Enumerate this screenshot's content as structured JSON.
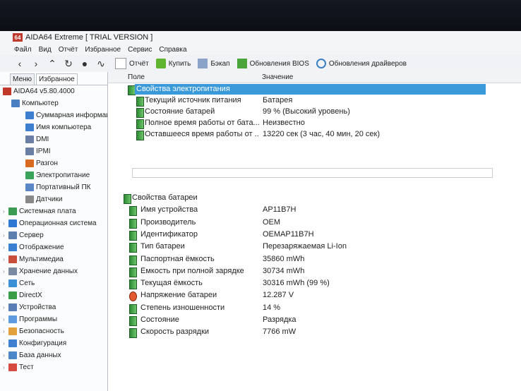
{
  "window": {
    "title": "AIDA64 Extreme  [ TRIAL VERSION ]",
    "app_badge": "64"
  },
  "menu": [
    "Файл",
    "Вид",
    "Отчёт",
    "Избранное",
    "Сервис",
    "Справка"
  ],
  "toolbar": {
    "report": "Отчёт",
    "buy": "Купить",
    "backup": "Бэкап",
    "bios_updates": "Обновления BIOS",
    "driver_updates": "Обновления драйверов"
  },
  "left_tabs": [
    "Меню",
    "Избранное"
  ],
  "tree": [
    {
      "label": "AIDA64 v5.80.4000",
      "indent": 0,
      "icon": "aida-icon"
    },
    {
      "label": "Компьютер",
      "indent": 1,
      "icon": "computer-icon"
    },
    {
      "label": "Суммарная информац",
      "indent": 2,
      "icon": "summary-icon"
    },
    {
      "label": "Имя компьютера",
      "indent": 2,
      "icon": "computer-name-icon"
    },
    {
      "label": "DMI",
      "indent": 2,
      "icon": "dmi-icon"
    },
    {
      "label": "IPMI",
      "indent": 2,
      "icon": "ipmi-icon"
    },
    {
      "label": "Разгон",
      "indent": 2,
      "icon": "overclock-icon"
    },
    {
      "label": "Электропитание",
      "indent": 2,
      "icon": "power-icon"
    },
    {
      "label": "Портативный ПК",
      "indent": 2,
      "icon": "laptop-icon"
    },
    {
      "label": "Датчики",
      "indent": 2,
      "icon": "sensor-icon"
    },
    {
      "label": "Системная плата",
      "indent": 0,
      "icon": "motherboard-icon"
    },
    {
      "label": "Операционная система",
      "indent": 0,
      "icon": "windows-icon"
    },
    {
      "label": "Сервер",
      "indent": 0,
      "icon": "server-icon"
    },
    {
      "label": "Отображение",
      "indent": 0,
      "icon": "display-icon"
    },
    {
      "label": "Мультимедиа",
      "indent": 0,
      "icon": "multimedia-icon"
    },
    {
      "label": "Хранение данных",
      "indent": 0,
      "icon": "storage-icon"
    },
    {
      "label": "Сеть",
      "indent": 0,
      "icon": "network-icon"
    },
    {
      "label": "DirectX",
      "indent": 0,
      "icon": "directx-icon"
    },
    {
      "label": "Устройства",
      "indent": 0,
      "icon": "devices-icon"
    },
    {
      "label": "Программы",
      "indent": 0,
      "icon": "programs-icon"
    },
    {
      "label": "Безопасность",
      "indent": 0,
      "icon": "security-icon"
    },
    {
      "label": "Конфигурация",
      "indent": 0,
      "icon": "config-icon"
    },
    {
      "label": "База данных",
      "indent": 0,
      "icon": "database-icon"
    },
    {
      "label": "Тест",
      "indent": 0,
      "icon": "test-icon"
    }
  ],
  "columns": {
    "field": "Поле",
    "value": "Значение"
  },
  "sections": [
    {
      "title": "Свойства электропитания",
      "selected": true,
      "rows": [
        {
          "field": "Текущий источник питания",
          "value": "Батарея"
        },
        {
          "field": "Состояние батарей",
          "value": "99 % (Высокий уровень)"
        },
        {
          "field": "Полное время работы от бата...",
          "value": "Неизвестно"
        },
        {
          "field": "Оставшееся время работы от ...",
          "value": "13220 сек (3 час, 40 мин, 20 сек)"
        }
      ]
    },
    {
      "title": "Свойства батареи",
      "selected": false,
      "rows": [
        {
          "field": "Имя устройства",
          "value": "AP11B7H"
        },
        {
          "field": "Производитель",
          "value": "OEM"
        },
        {
          "field": "Идентификатор",
          "value": "OEMAP11B7H"
        },
        {
          "field": "Тип батареи",
          "value": "Перезаряжаемая Li-Ion"
        },
        {
          "field": "Паспортная ёмкость",
          "value": "35860 mWh"
        },
        {
          "field": "Ёмкость при полной зарядке",
          "value": "30734 mWh"
        },
        {
          "field": "Текущая ёмкость",
          "value": "30316 mWh  (99 %)"
        },
        {
          "field": "Напряжение батареи",
          "value": "12.287 V"
        },
        {
          "field": "Степень изношенности",
          "value": "14 %"
        },
        {
          "field": "Состояние",
          "value": "Разрядка"
        },
        {
          "field": "Скорость разрядки",
          "value": "7766 mW"
        }
      ]
    }
  ],
  "colors": {
    "selection": "#3a9ad9",
    "battery_icon": "#3fa345",
    "app_badge": "#c0392b"
  }
}
